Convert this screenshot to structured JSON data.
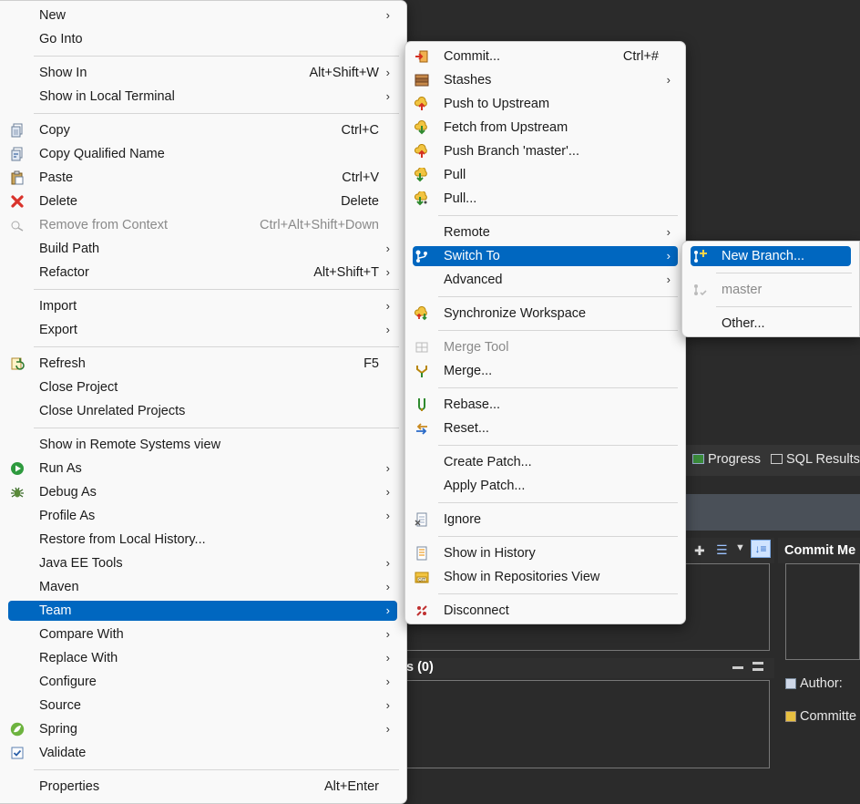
{
  "background": {
    "tabs": [
      "Progress",
      "SQL Results"
    ],
    "commit_label": "Commit Me",
    "staged_label": "s (0)",
    "author_label": "Author:",
    "committer_label": "Committe"
  },
  "menu1": {
    "items": [
      {
        "label": "New",
        "shortcut": "",
        "submenu": true
      },
      {
        "label": "Go Into"
      },
      {
        "label": "Show In",
        "shortcut": "Alt+Shift+W",
        "submenu": true
      },
      {
        "label": "Show in Local Terminal",
        "submenu": true
      },
      {
        "label": "Copy",
        "shortcut": "Ctrl+C",
        "icon": "copy-icon"
      },
      {
        "label": "Copy Qualified Name",
        "icon": "copy-qualified-icon"
      },
      {
        "label": "Paste",
        "shortcut": "Ctrl+V",
        "icon": "paste-icon"
      },
      {
        "label": "Delete",
        "shortcut": "Delete",
        "icon": "delete-icon"
      },
      {
        "label": "Remove from Context",
        "shortcut": "Ctrl+Alt+Shift+Down",
        "icon": "remove-context-icon",
        "disabled": true
      },
      {
        "label": "Build Path",
        "submenu": true
      },
      {
        "label": "Refactor",
        "shortcut": "Alt+Shift+T",
        "submenu": true
      },
      {
        "label": "Import",
        "submenu": true
      },
      {
        "label": "Export",
        "submenu": true
      },
      {
        "label": "Refresh",
        "shortcut": "F5",
        "icon": "refresh-icon"
      },
      {
        "label": "Close Project"
      },
      {
        "label": "Close Unrelated Projects"
      },
      {
        "label": "Show in Remote Systems view"
      },
      {
        "label": "Run As",
        "submenu": true,
        "icon": "run-icon"
      },
      {
        "label": "Debug As",
        "submenu": true,
        "icon": "debug-icon"
      },
      {
        "label": "Profile As",
        "submenu": true
      },
      {
        "label": "Restore from Local History..."
      },
      {
        "label": "Java EE Tools",
        "submenu": true
      },
      {
        "label": "Maven",
        "submenu": true
      },
      {
        "label": "Team",
        "submenu": true,
        "selected": true
      },
      {
        "label": "Compare With",
        "submenu": true
      },
      {
        "label": "Replace With",
        "submenu": true
      },
      {
        "label": "Configure",
        "submenu": true
      },
      {
        "label": "Source",
        "submenu": true
      },
      {
        "label": "Spring",
        "submenu": true,
        "icon": "spring-icon"
      },
      {
        "label": "Validate",
        "icon": "validate-checkbox-icon"
      },
      {
        "label": "Properties",
        "shortcut": "Alt+Enter"
      }
    ]
  },
  "menu2": {
    "items": [
      {
        "label": "Commit...",
        "shortcut": "Ctrl+#",
        "icon": "commit-icon"
      },
      {
        "label": "Stashes",
        "submenu": true,
        "icon": "stash-icon"
      },
      {
        "label": "Push to Upstream",
        "icon": "push-icon"
      },
      {
        "label": "Fetch from Upstream",
        "icon": "fetch-icon"
      },
      {
        "label": "Push Branch 'master'...",
        "icon": "push-branch-icon"
      },
      {
        "label": "Pull",
        "icon": "pull-icon"
      },
      {
        "label": "Pull...",
        "icon": "pull-dialog-icon"
      },
      {
        "label": "Remote",
        "submenu": true
      },
      {
        "label": "Switch To",
        "submenu": true,
        "selected": true,
        "icon": "switch-branch-icon"
      },
      {
        "label": "Advanced",
        "submenu": true
      },
      {
        "label": "Synchronize Workspace",
        "icon": "synchronize-icon"
      },
      {
        "label": "Merge Tool",
        "disabled": true,
        "icon": "merge-tool-icon"
      },
      {
        "label": "Merge...",
        "icon": "merge-icon"
      },
      {
        "label": "Rebase...",
        "icon": "rebase-icon"
      },
      {
        "label": "Reset...",
        "icon": "reset-icon"
      },
      {
        "label": "Create Patch..."
      },
      {
        "label": "Apply Patch..."
      },
      {
        "label": "Ignore",
        "icon": "ignore-icon"
      },
      {
        "label": "Show in History",
        "icon": "history-icon"
      },
      {
        "label": "Show in Repositories View",
        "icon": "repositories-icon"
      },
      {
        "label": "Disconnect",
        "icon": "disconnect-icon"
      }
    ]
  },
  "menu3": {
    "items": [
      {
        "label": "New Branch...",
        "selected": true,
        "icon": "new-branch-icon"
      },
      {
        "label": "master",
        "disabled": true,
        "icon": "branch-checked-icon"
      },
      {
        "label": "Other..."
      }
    ]
  },
  "colors": {
    "selection": "#0067c0",
    "menu_bg": "#f9f9f9",
    "ide_bg": "#2b2b2b"
  }
}
